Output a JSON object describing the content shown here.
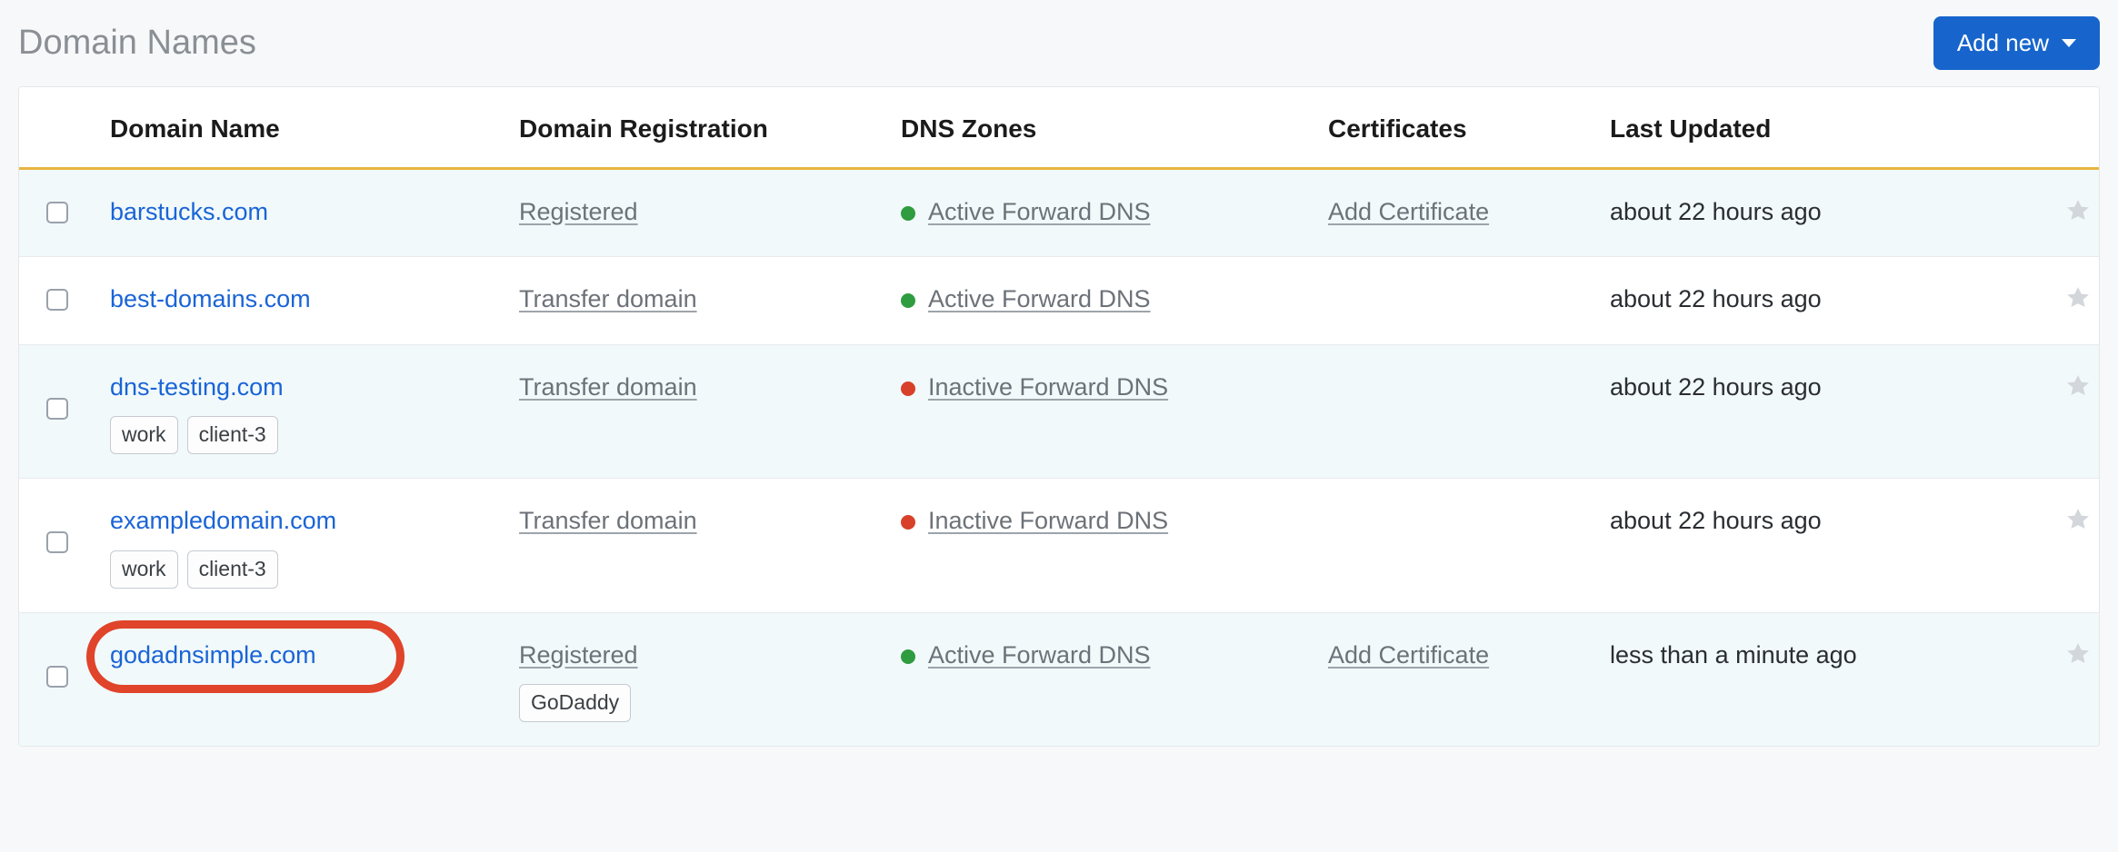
{
  "page": {
    "title": "Domain Names",
    "add_button": "Add new"
  },
  "table": {
    "headers": {
      "name": "Domain Name",
      "registration": "Domain Registration",
      "dns": "DNS Zones",
      "certificates": "Certificates",
      "updated": "Last Updated"
    },
    "rows": [
      {
        "domain": "barstucks.com",
        "registration": "Registered",
        "dns_status": "active",
        "dns_label": "Active Forward DNS",
        "certificate": "Add Certificate",
        "updated": "about 22 hours ago",
        "tags": [],
        "reg_tags": [],
        "highlighted": false
      },
      {
        "domain": "best-domains.com",
        "registration": "Transfer domain",
        "dns_status": "active",
        "dns_label": "Active Forward DNS",
        "certificate": "",
        "updated": "about 22 hours ago",
        "tags": [],
        "reg_tags": [],
        "highlighted": false
      },
      {
        "domain": "dns-testing.com",
        "registration": "Transfer domain",
        "dns_status": "inactive",
        "dns_label": "Inactive Forward DNS",
        "certificate": "",
        "updated": "about 22 hours ago",
        "tags": [
          "work",
          "client-3"
        ],
        "reg_tags": [],
        "highlighted": false
      },
      {
        "domain": "exampledomain.com",
        "registration": "Transfer domain",
        "dns_status": "inactive",
        "dns_label": "Inactive Forward DNS",
        "certificate": "",
        "updated": "about 22 hours ago",
        "tags": [
          "work",
          "client-3"
        ],
        "reg_tags": [],
        "highlighted": false
      },
      {
        "domain": "godadnsimple.com",
        "registration": "Registered",
        "dns_status": "active",
        "dns_label": "Active Forward DNS",
        "certificate": "Add Certificate",
        "updated": "less than a minute ago",
        "tags": [],
        "reg_tags": [
          "GoDaddy"
        ],
        "highlighted": true
      }
    ]
  },
  "colors": {
    "link_blue": "#1a64d6",
    "button_blue": "#1765cc",
    "header_rule": "#e8b441",
    "dot_active": "#2e9c3f",
    "dot_inactive": "#d9402a",
    "highlight_ring": "#e0442a"
  },
  "icons": {
    "star": "star-icon",
    "caret_down": "chevron-down-icon"
  }
}
